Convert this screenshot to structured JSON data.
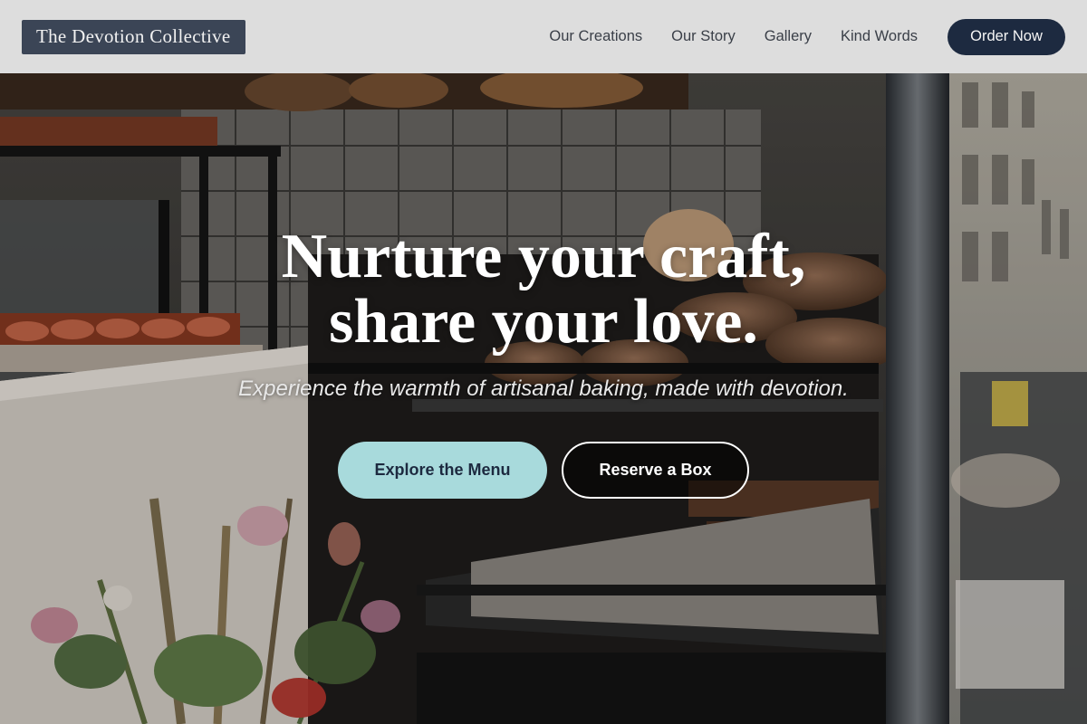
{
  "brand": {
    "logo_text": "The Devotion Collective"
  },
  "nav": {
    "items": [
      {
        "label": "Our Creations"
      },
      {
        "label": "Our Story"
      },
      {
        "label": "Gallery"
      },
      {
        "label": "Kind Words"
      }
    ],
    "cta_label": "Order Now"
  },
  "hero": {
    "headline_line1": "Nurture your craft,",
    "headline_line2": "share your love.",
    "subheadline": "Experience the warmth of artisanal baking, made with devotion.",
    "primary_button": "Explore the Menu",
    "secondary_button": "Reserve a Box",
    "background_image": "bakery-window-with-pastries-and-flowers"
  },
  "colors": {
    "header_bg": "#dddddd",
    "logo_bg": "#3b4556",
    "cta_bg": "#1d2a40",
    "primary_button_bg": "#a8dadc",
    "nav_text": "#3a3f48"
  }
}
